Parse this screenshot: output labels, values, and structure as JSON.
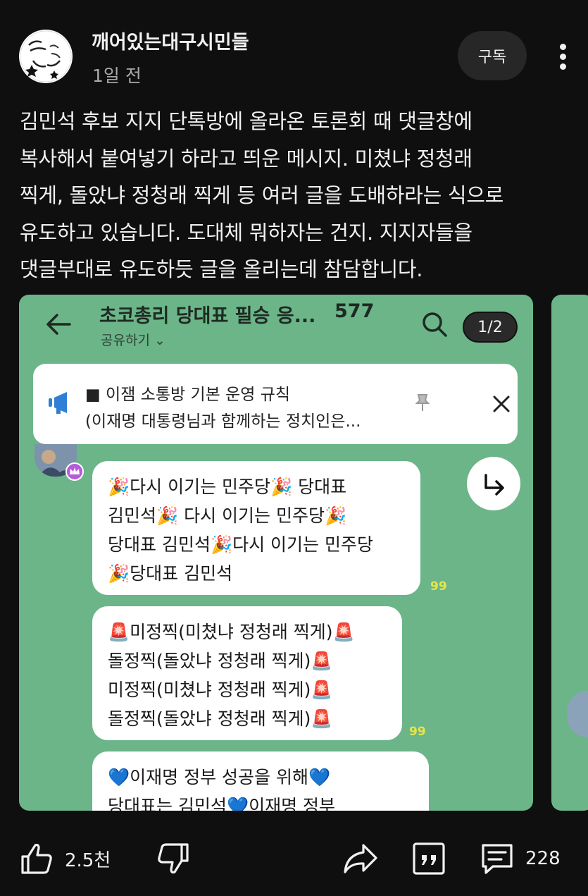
{
  "header": {
    "channel_name": "깨어있는대구시민들",
    "post_time": "1일 전",
    "subscribe_label": "구독",
    "avatar_text": "깨어있는대구시민들"
  },
  "post": {
    "lines": [
      "김민석 후보 지지 단톡방에 올라온 토론회 때 댓글창에",
      "복사해서 붙여넣기 하라고 띄운 메시지. 미쳤냐 정청래",
      "찍게, 돌았냐 정청래 찍게 등 여러 글을 도배하라는 식으로",
      "유도하고 있습니다. 도대체 뭐하자는 건지. 지지자들을",
      "댓글부대로 유도하듯 글을 올리는데 참담합니다."
    ]
  },
  "chat": {
    "title": "초코총리 당대표 필승 응...",
    "member_count": "577",
    "share_label": "공유하기",
    "page_indicator": "1/2",
    "notice": {
      "line1": "■ 이잼 소통방 기본 운영 규칙",
      "line2": "(이재명 대통령님과 함께하는 정치인은..."
    },
    "messages": [
      {
        "lines": [
          "🎉다시 이기는 민주당🎉 당대표",
          "김민석🎉 다시 이기는 민주당🎉",
          "당대표 김민석🎉다시 이기는 민주당",
          "🎉당대표 김민석"
        ],
        "read_count": "99"
      },
      {
        "lines": [
          "🚨미정찍(미쳤냐 정청래 찍게)🚨",
          "돌정찍(돌았냐 정청래 찍게)🚨",
          "미정찍(미쳤냐 정청래 찍게)🚨",
          "돌정찍(돌았냐 정청래 찍게)🚨"
        ],
        "read_count": "99"
      },
      {
        "lines": [
          "💙이재명 정부 성공을 위해💙",
          "당대표는 김민석💙이재명 정부"
        ],
        "read_count": ""
      }
    ]
  },
  "actions": {
    "like_count": "2.5천",
    "comment_count": "228"
  },
  "icons": {
    "like": "thumbs-up-icon",
    "dislike": "thumbs-down-icon",
    "share": "share-icon",
    "quote": "quote-icon",
    "comment": "comment-icon",
    "more": "more-vert-icon"
  },
  "colors": {
    "background": "#0f0f0f",
    "chat_background": "#6bb589",
    "bubble": "#ffffff",
    "read_count": "#e6e64a"
  }
}
